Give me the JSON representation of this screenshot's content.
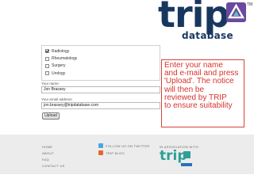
{
  "logo": {
    "wordmark": "trip",
    "sub": "database",
    "tm": "TM"
  },
  "form": {
    "specialties": [
      {
        "label": "Radiology",
        "checked": true
      },
      {
        "label": "Rheumatology",
        "checked": false
      },
      {
        "label": "Surgery",
        "checked": false
      },
      {
        "label": "Urology",
        "checked": false
      }
    ],
    "name_label": "Your name:",
    "name_value": "Jon Brassey",
    "email_label": "Your email address:",
    "email_value": "jon.brassey@tripdatabase.com",
    "upload_label": "Upload"
  },
  "note": {
    "lines": [
      "Enter your name",
      "and e-mail and press",
      "'Upload'. The notice",
      "will then be",
      "reviewed by TRIP",
      "to ensure suitability"
    ]
  },
  "footer": {
    "links": [
      "HOME",
      "ABOUT",
      "FAQ",
      "CONTACT US"
    ],
    "social": [
      {
        "label": "FOLLOW US ON TWITTER",
        "icon": "twitter-icon",
        "color": "#4aa8e0"
      },
      {
        "label": "TRIP BLOG",
        "icon": "blog-icon",
        "color": "#e8662a"
      }
    ],
    "association_label": "IN ASSOCIATION WITH",
    "partner_logo_text": "trip"
  },
  "colors": {
    "brand_navy": "#18375f",
    "brand_purple": "#6a4a9e",
    "note_red": "#d6332b",
    "partner_teal": "#2e9f96"
  }
}
